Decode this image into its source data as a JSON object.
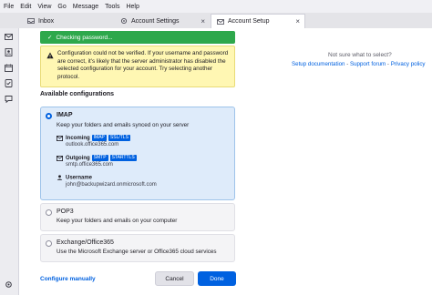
{
  "menubar": {
    "items": [
      "File",
      "Edit",
      "View",
      "Go",
      "Message",
      "Tools",
      "Help"
    ]
  },
  "tabs": [
    {
      "label": "Inbox",
      "icon": "inbox-icon"
    },
    {
      "label": "Account Settings",
      "icon": "gear-icon"
    },
    {
      "label": "Account Setup",
      "icon": "mail-icon",
      "active": true
    }
  ],
  "banner": {
    "status": "Checking password...",
    "warning": "Configuration could not be verified. If your username and password are correct, it's likely that the server administrator has disabled the selected configuration for your account. Try selecting another protocol."
  },
  "configs": {
    "heading": "Available configurations",
    "imap": {
      "title": "IMAP",
      "desc": "Keep your folders and emails synced on your server",
      "incoming_label": "Incoming",
      "incoming_badges": [
        "IMAP",
        "SSL/TLS"
      ],
      "incoming_value": "outlook.office365.com",
      "outgoing_label": "Outgoing",
      "outgoing_badges": [
        "SMTP",
        "STARTTLS"
      ],
      "outgoing_value": "smtp.office365.com",
      "username_label": "Username",
      "username_value": "john@backupwizard.onmicrosoft.com"
    },
    "pop3": {
      "title": "POP3",
      "desc": "Keep your folders and emails on your computer"
    },
    "exchange": {
      "title": "Exchange/Office365",
      "desc": "Use the Microsoft Exchange server or Office365 cloud services"
    }
  },
  "footer": {
    "configure": "Configure manually",
    "cancel": "Cancel",
    "done": "Done"
  },
  "side": {
    "question": "Not sure what to select?",
    "links": [
      "Setup documentation",
      "Support forum",
      "Privacy policy"
    ],
    "sep": " - "
  },
  "colors": {
    "accent": "#0061e0",
    "success": "#2ea84c",
    "warning_bg": "#fff7b3"
  }
}
